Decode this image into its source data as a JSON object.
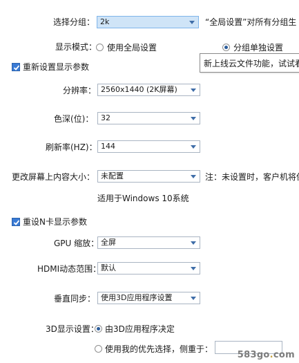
{
  "group": {
    "label": "选择分组：",
    "value": "2k",
    "note": "“全局设置”对所有分组生"
  },
  "display_mode": {
    "label": "显示模式：",
    "options": [
      "使用全局设置",
      "分组单独设置"
    ],
    "selected": "分组单独设置",
    "tooltip": "新上线云文件功能，试试看"
  },
  "reset_display": {
    "label": "重新设置显示参数",
    "checked": true
  },
  "resolution": {
    "label": "分辨率：",
    "value": "2560x1440 (2K屏幕)"
  },
  "color_depth": {
    "label": "色深(位)：",
    "value": "32"
  },
  "refresh_rate": {
    "label": "刷新率(HZ)：",
    "value": "144"
  },
  "content_size": {
    "label": "更改屏幕上内容大小：",
    "value": "未配置",
    "note": "注：未设置时，客户机将保",
    "applies_to": "适用于Windows 10系统"
  },
  "reset_gpu": {
    "label": "重设N卡显示参数",
    "checked": true
  },
  "gpu_scaling": {
    "label": "GPU 缩放：",
    "value": "全屏"
  },
  "hdmi_range": {
    "label": "HDMI动态范围：",
    "value": "默认"
  },
  "vsync": {
    "label": "垂直同步：",
    "value": "使用3D应用程序设置"
  },
  "settings_3d": {
    "label": "3D显示设置：",
    "options": [
      "由3D应用程序决定",
      "使用我的优先选择，侧重于："
    ],
    "selected": "由3D应用程序决定",
    "preference_value": ""
  },
  "watermark": {
    "text_main": "583go",
    "text_dot": ".",
    "text_tail": "com"
  }
}
